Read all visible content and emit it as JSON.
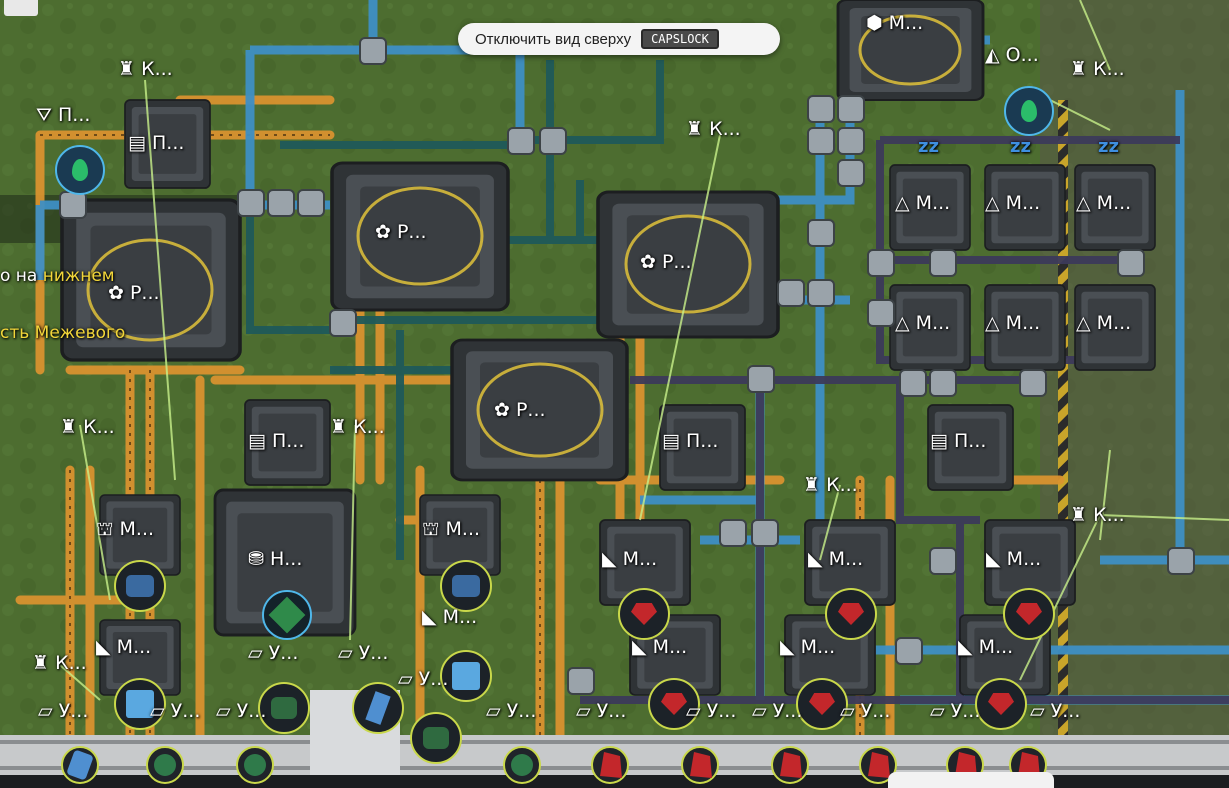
{
  "hud": {
    "toggle_view_label": "Отключить вид сверху",
    "toggle_view_key": "CAPSLOCK",
    "hint_line1_prefix": "о на ",
    "hint_line1_highlight": "нижнем",
    "hint_line2": "сть Межевого"
  },
  "colors": {
    "ground": "#4a6a2e",
    "pipe_blue": "#3e8fc4",
    "pipe_teal": "#1f5a5a",
    "pipe_purple": "#3c3a5a",
    "belt_orange": "#d9922f",
    "building": "#3c4044",
    "accent_yellow": "#e0c23a",
    "ore_red": "#c3272b",
    "crystal_blue": "#4f8fd0"
  },
  "labels": {
    "k1": "К...",
    "k2": "К...",
    "k3": "К...",
    "k4": "К...",
    "k5": "К...",
    "k6": "К...",
    "k7": "К...",
    "k8": "К...",
    "p1": "П...",
    "p2": "П...",
    "p3": "П...",
    "p4": "П...",
    "p5": "П...",
    "r1": "Р...",
    "r2": "Р...",
    "r3": "Р...",
    "r4": "Р...",
    "m1": "М...",
    "m2": "М...",
    "m3": "М...",
    "m4": "М...",
    "m5": "М...",
    "m6": "М...",
    "m7": "М...",
    "m8": "М...",
    "m9": "М...",
    "m10": "М...",
    "m11": "М...",
    "m12": "М...",
    "m13": "М...",
    "m14": "М...",
    "m15": "М...",
    "m16": "М...",
    "m17": "М...",
    "n1": "Н...",
    "o1": "О...",
    "u1": "У...",
    "u2": "У...",
    "u3": "У...",
    "u4": "У...",
    "u5": "У...",
    "u6": "У...",
    "u7": "У...",
    "u8": "У...",
    "u9": "У...",
    "u10": "У...",
    "u11": "У...",
    "u12": "У...",
    "u13": "У..."
  }
}
